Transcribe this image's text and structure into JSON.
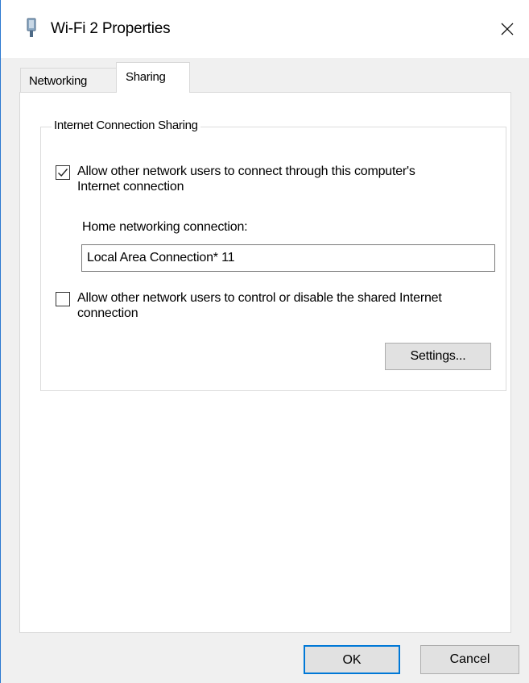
{
  "window": {
    "title": "Wi-Fi 2 Properties",
    "icon": "network-adapter-icon",
    "close_icon": "close-icon"
  },
  "tabs": [
    {
      "label": "Networking",
      "selected": false
    },
    {
      "label": "Sharing",
      "selected": true
    }
  ],
  "sharing": {
    "group_label": "Internet Connection Sharing",
    "allow_connect": {
      "label": "Allow other network users to connect through this computer's Internet connection",
      "checked": true
    },
    "home_networking_label": "Home networking connection:",
    "home_networking_value": "Local Area Connection* 11",
    "allow_control": {
      "label": "Allow other network users to control or disable the shared Internet connection",
      "checked": false
    },
    "settings_button": "Settings..."
  },
  "footer": {
    "ok_label": "OK",
    "cancel_label": "Cancel"
  },
  "colors": {
    "accent": "#0078d7",
    "window_border": "#2b79d0",
    "dialog_background": "#f0f0f0",
    "button_face": "#e1e1e1"
  }
}
